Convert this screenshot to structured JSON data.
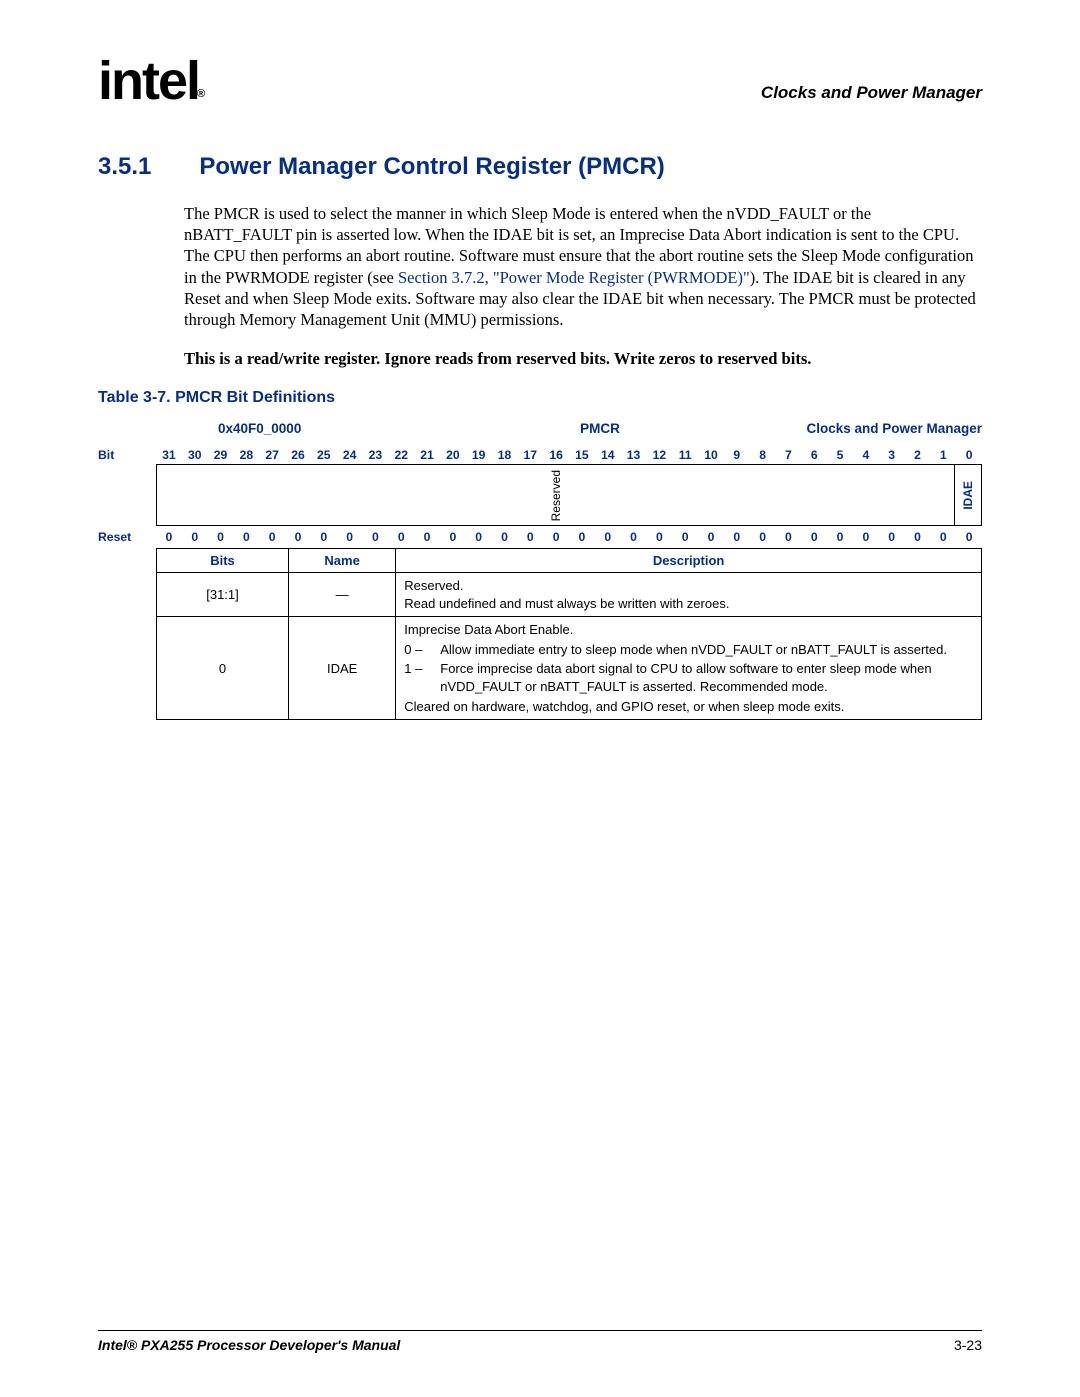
{
  "header": {
    "logo_text": "intel",
    "logo_reg": "®",
    "chapter_title": "Clocks and Power Manager"
  },
  "section": {
    "number": "3.5.1",
    "title": "Power Manager Control Register (PMCR)"
  },
  "paragraph": {
    "text_before_link": "The PMCR is used to select the manner in which Sleep Mode is entered when the nVDD_FAULT or the nBATT_FAULT pin is asserted low. When the IDAE bit is set, an Imprecise Data Abort indication is sent to the CPU. The CPU then performs an abort routine. Software must ensure that the abort routine sets the Sleep Mode configuration in the PWRMODE register (see ",
    "link_text": "Section 3.7.2, \"Power Mode Register (PWRMODE)\"",
    "text_after_link": "). The IDAE bit is cleared in any Reset and when Sleep Mode exits. Software may also clear the IDAE bit when necessary. The PMCR must be protected through Memory Management Unit (MMU) permissions."
  },
  "note": "This is a read/write register. Ignore reads from reserved bits. Write zeros to reserved bits.",
  "table_caption": "Table 3-7. PMCR Bit Definitions",
  "reg_header": {
    "address": "0x40F0_0000",
    "name": "PMCR",
    "module": "Clocks and Power Manager"
  },
  "bit_label": "Bit",
  "reset_label": "Reset",
  "bit_numbers": [
    "31",
    "30",
    "29",
    "28",
    "27",
    "26",
    "25",
    "24",
    "23",
    "22",
    "21",
    "20",
    "19",
    "18",
    "17",
    "16",
    "15",
    "14",
    "13",
    "12",
    "11",
    "10",
    "9",
    "8",
    "7",
    "6",
    "5",
    "4",
    "3",
    "2",
    "1",
    "0"
  ],
  "fields": {
    "reserved": "Reserved",
    "idae": "IDAE"
  },
  "reset_values": [
    "0",
    "0",
    "0",
    "0",
    "0",
    "0",
    "0",
    "0",
    "0",
    "0",
    "0",
    "0",
    "0",
    "0",
    "0",
    "0",
    "0",
    "0",
    "0",
    "0",
    "0",
    "0",
    "0",
    "0",
    "0",
    "0",
    "0",
    "0",
    "0",
    "0",
    "0",
    "0"
  ],
  "desc_headers": {
    "bits": "Bits",
    "name": "Name",
    "desc": "Description"
  },
  "desc_rows": [
    {
      "bits": "[31:1]",
      "name": "—",
      "desc_lines": [
        "Reserved.",
        "Read undefined and must always be written with zeroes."
      ]
    },
    {
      "bits": "0",
      "name": "IDAE",
      "desc_prefix": "Imprecise Data Abort Enable.",
      "items": [
        {
          "num": "0 –",
          "text": "Allow immediate entry to sleep mode when nVDD_FAULT or nBATT_FAULT is asserted."
        },
        {
          "num": "1 –",
          "text": "Force imprecise data abort signal to CPU to allow software to enter sleep mode when nVDD_FAULT or nBATT_FAULT is asserted. Recommended mode."
        }
      ],
      "desc_suffix": "Cleared on hardware, watchdog, and GPIO reset, or when sleep mode exits."
    }
  ],
  "footer": {
    "title": "Intel® PXA255 Processor Developer's Manual",
    "page": "3-23"
  }
}
